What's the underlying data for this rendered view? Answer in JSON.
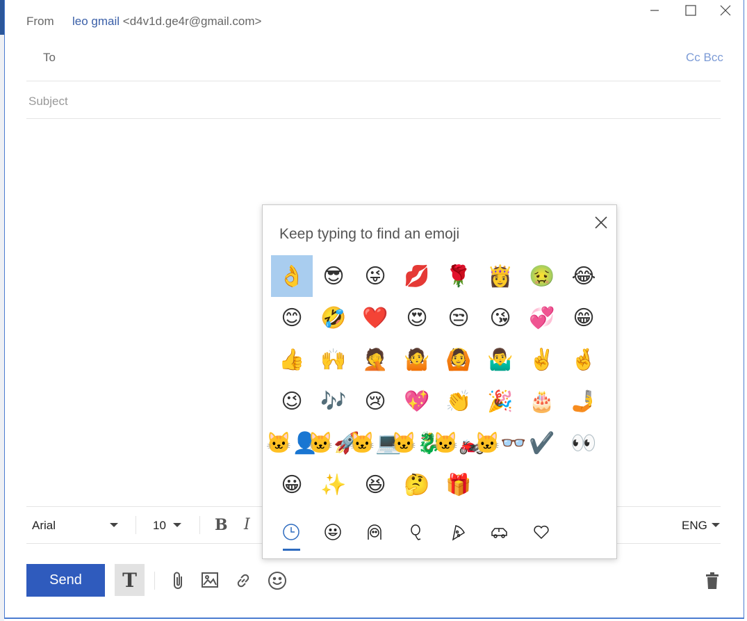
{
  "header": {
    "from_label": "From",
    "from_name": "leo gmail",
    "from_address": "<d4v1d.ge4r@gmail.com>",
    "to_label": "To",
    "cc_bcc": "Cc Bcc",
    "subject_placeholder": "Subject"
  },
  "format_toolbar": {
    "font_family": "Arial",
    "font_size": "10",
    "bold_glyph": "B",
    "italic_glyph": "I",
    "language": "ENG"
  },
  "actions": {
    "send_label": "Send",
    "text_format_glyph": "T"
  },
  "emoji_panel": {
    "hint": "Keep typing to find an emoji",
    "selected_index": 0,
    "emojis": [
      "👌",
      "😎",
      "😜",
      "💋",
      "🌹",
      "👸",
      "🤢",
      "😂",
      "😊",
      "🤣",
      "❤️",
      "😍",
      "😒",
      "😘",
      "💞",
      "😁",
      "👍",
      "🙌",
      "🤦",
      "🤷",
      "🙆",
      "🤷‍♂️",
      "✌️",
      "🤞",
      "😉",
      "🎶",
      "😢",
      "💖",
      "👏",
      "🎉",
      "🎂",
      "🤳",
      "🐱‍👤",
      "🐱‍🚀",
      "🐱‍💻",
      "🐱‍🐉",
      "🐱‍🏍",
      "🐱‍👓",
      "✔️",
      "👀",
      "😀",
      "✨",
      "😆",
      "🤔",
      "🎁"
    ],
    "categories": [
      "recent-icon",
      "smiley-icon",
      "people-icon",
      "balloon-icon",
      "pizza-icon",
      "car-icon",
      "heart-icon"
    ],
    "active_category": "recent-icon"
  },
  "colors": {
    "accent": "#2f5bbd",
    "link": "#3a5fa8",
    "selected_emoji": "#a9cdef",
    "active_tab": "#2d6bbf"
  }
}
